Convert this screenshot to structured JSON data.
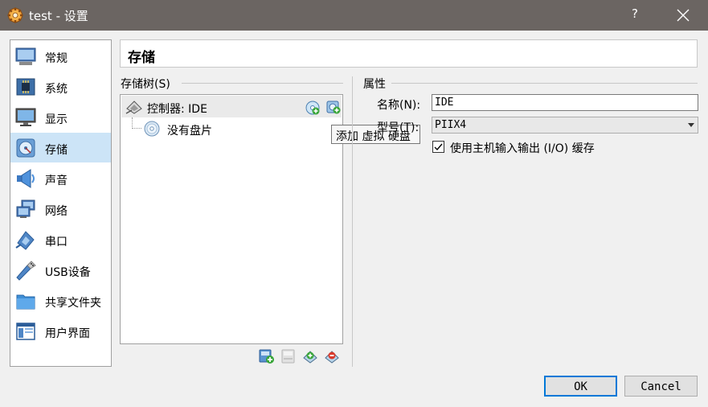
{
  "window": {
    "title": "test - 设置",
    "help": "?"
  },
  "sidebar": {
    "items": [
      {
        "label": "常规",
        "icon": "general-icon",
        "selected": false
      },
      {
        "label": "系统",
        "icon": "system-icon",
        "selected": false
      },
      {
        "label": "显示",
        "icon": "display-icon",
        "selected": false
      },
      {
        "label": "存储",
        "icon": "storage-icon",
        "selected": true
      },
      {
        "label": "声音",
        "icon": "audio-icon",
        "selected": false
      },
      {
        "label": "网络",
        "icon": "network-icon",
        "selected": false
      },
      {
        "label": "串口",
        "icon": "serial-port-icon",
        "selected": false
      },
      {
        "label": "USB设备",
        "icon": "usb-icon",
        "selected": false
      },
      {
        "label": "共享文件夹",
        "icon": "shared-folder-icon",
        "selected": false
      },
      {
        "label": "用户界面",
        "icon": "user-interface-icon",
        "selected": false
      }
    ]
  },
  "page": {
    "title": "存储"
  },
  "storage_tree": {
    "label": "存储树(S)",
    "controller_label": "控制器: IDE",
    "attachments": [
      "没有盘片"
    ],
    "tooltip": "添加 虚拟 硬盘"
  },
  "attributes": {
    "label": "属性",
    "name_label": "名称(N):",
    "name_value": "IDE",
    "type_label": "型号(T):",
    "type_value": "PIIX4",
    "cache_label": "使用主机输入输出 (I/O) 缓存",
    "cache_checked": true
  },
  "buttons": {
    "ok": "OK",
    "cancel": "Cancel"
  },
  "colors": {
    "titlebar": "#6b6562",
    "selection": "#cce4f7",
    "ok_border": "#0078d7"
  }
}
